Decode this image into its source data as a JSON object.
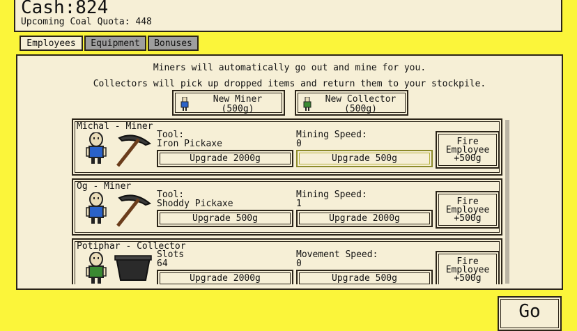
{
  "header": {
    "cash_label": "Cash:",
    "cash_value": "824",
    "quota_label": "Upcoming Coal Quota:",
    "quota_value": "448"
  },
  "tabs": [
    {
      "label": "Employees",
      "active": true
    },
    {
      "label": "Equipment",
      "active": false
    },
    {
      "label": "Bonuses",
      "active": false
    }
  ],
  "info": {
    "line1": "Miners will automatically go out and mine for you.",
    "line2": "Collectors will pick up dropped items and return them to your stockpile."
  },
  "hire": {
    "miner": {
      "line1": "New Miner",
      "line2": "(500g)",
      "icon": "miner-figure-icon"
    },
    "collector": {
      "line1": "New Collector",
      "line2": "(500g)",
      "icon": "collector-figure-icon"
    }
  },
  "employees": [
    {
      "name": "Michal - Miner",
      "shirt": "#2a62c9",
      "tool_icon": "pickaxe-icon",
      "label1": "Tool:",
      "value1": "Iron Pickaxe",
      "label2": "Mining Speed:",
      "value2": "0",
      "upgrade1": "Upgrade 2000g",
      "upgrade2": "Upgrade 500g",
      "fire_l1": "Fire",
      "fire_l2": "Employee",
      "fire_l3": "+500g"
    },
    {
      "name": "Og - Miner",
      "shirt": "#2a62c9",
      "tool_icon": "pickaxe-icon",
      "label1": "Tool:",
      "value1": "Shoddy Pickaxe",
      "label2": "Mining Speed:",
      "value2": "1",
      "upgrade1": "Upgrade 500g",
      "upgrade2": "Upgrade 2000g",
      "fire_l1": "Fire",
      "fire_l2": "Employee",
      "fire_l3": "+500g"
    },
    {
      "name": "Potiphar - Collector",
      "shirt": "#3a8a32",
      "tool_icon": "minecart-icon",
      "label1": "Slots",
      "value1": "64",
      "label2": "Movement Speed:",
      "value2": "0",
      "upgrade1": "Upgrade 2000g",
      "upgrade2": "Upgrade 500g",
      "fire_l1": "Fire",
      "fire_l2": "Employee",
      "fire_l3": "+500g"
    }
  ],
  "go_label": "Go"
}
